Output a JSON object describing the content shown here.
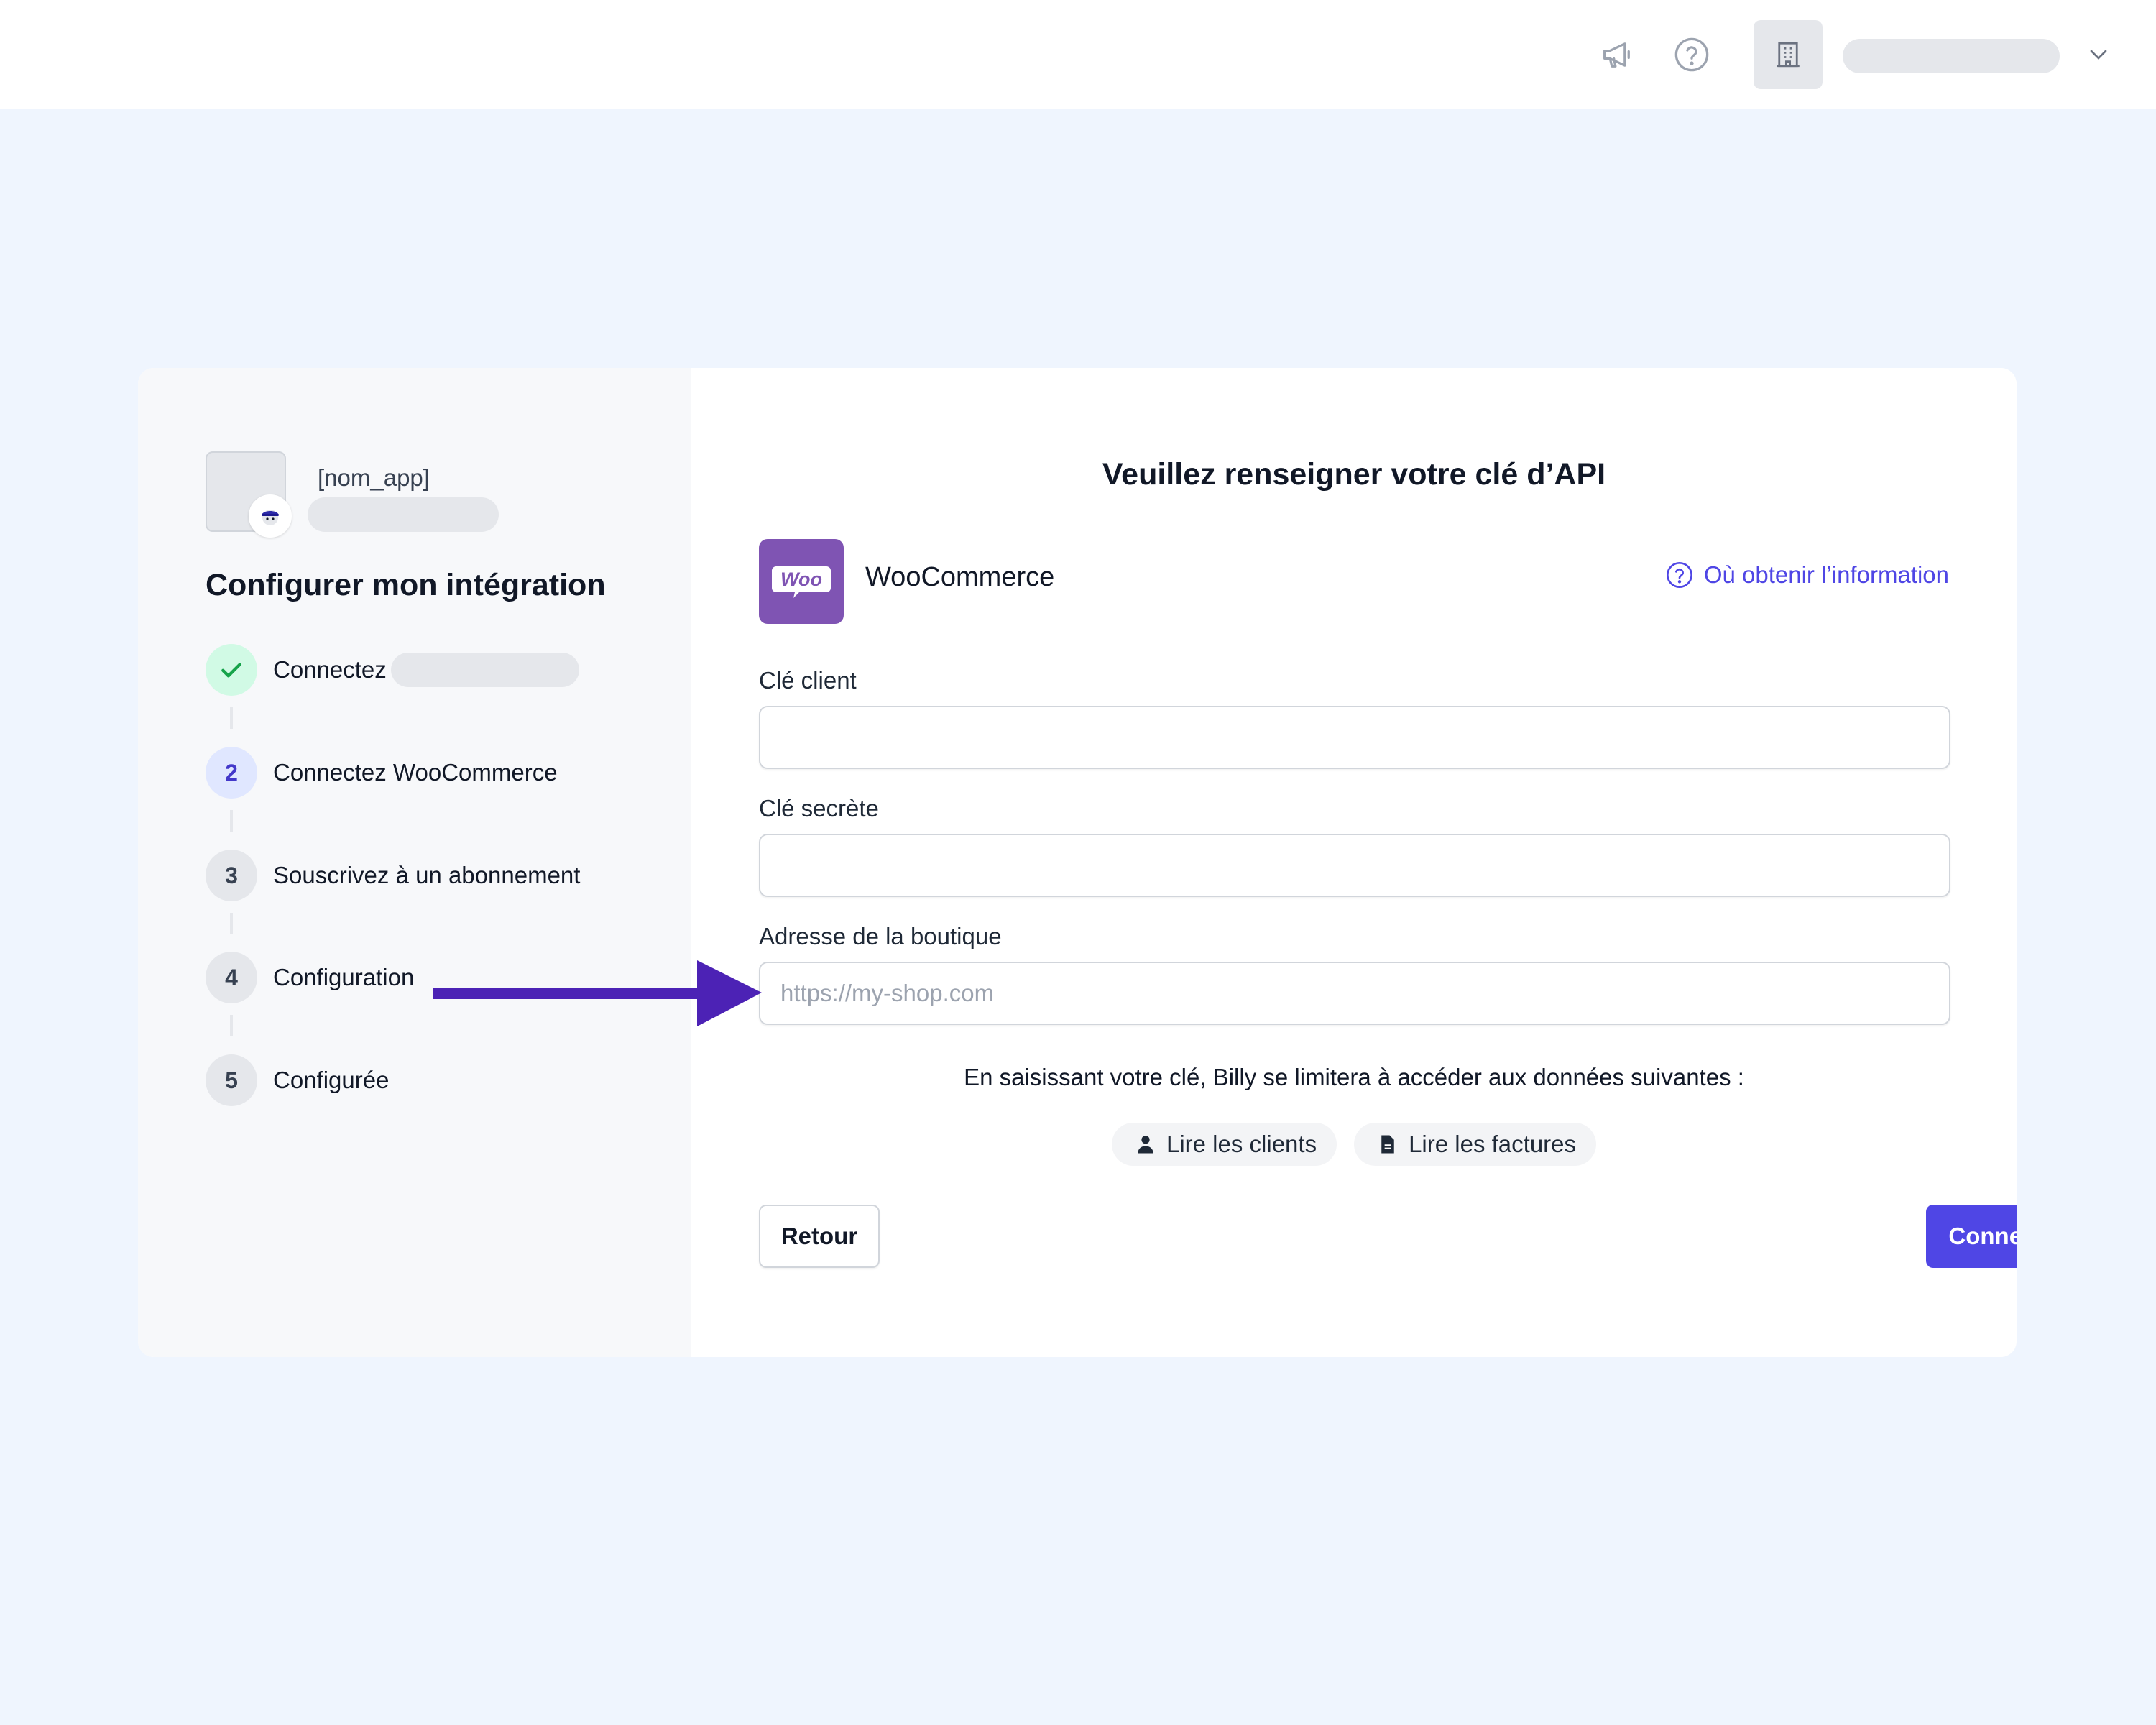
{
  "topbar": {
    "icons": [
      "megaphone-icon",
      "help-circle-icon",
      "building-icon",
      "chevron-down-icon"
    ]
  },
  "sidebar": {
    "app_name": "[nom_app]",
    "title": "Configurer mon intégration",
    "steps": [
      {
        "number": "",
        "label": "Connectez",
        "state": "done"
      },
      {
        "number": "2",
        "label": "Connectez WooCommerce",
        "state": "active"
      },
      {
        "number": "3",
        "label": "Souscrivez à un abonnement",
        "state": "todo"
      },
      {
        "number": "4",
        "label": "Configuration",
        "state": "todo"
      },
      {
        "number": "5",
        "label": "Configurée",
        "state": "todo"
      }
    ]
  },
  "main": {
    "title": "Veuillez renseigner votre clé d’API",
    "provider": {
      "name": "WooCommerce",
      "logo_text": "Woo"
    },
    "help_link": "Où obtenir l’information",
    "fields": [
      {
        "label": "Clé client",
        "value": "",
        "placeholder": ""
      },
      {
        "label": "Clé secrète",
        "value": "",
        "placeholder": ""
      },
      {
        "label": "Adresse de la boutique",
        "value": "",
        "placeholder": "https://my-shop.com"
      }
    ],
    "notice": "En saisissant votre clé, Billy se limitera à accéder aux données suivantes :",
    "permissions": [
      {
        "label": "Lire les clients",
        "icon": "user-icon"
      },
      {
        "label": "Lire les factures",
        "icon": "document-icon"
      }
    ],
    "back_label": "Retour",
    "connect_label": "Connecter"
  },
  "colors": {
    "accent": "#4f46e5",
    "woo_purple": "#7f54b3",
    "arrow": "#4c22b5",
    "page_bg": "#eff5fe",
    "success": "#16a34a"
  }
}
